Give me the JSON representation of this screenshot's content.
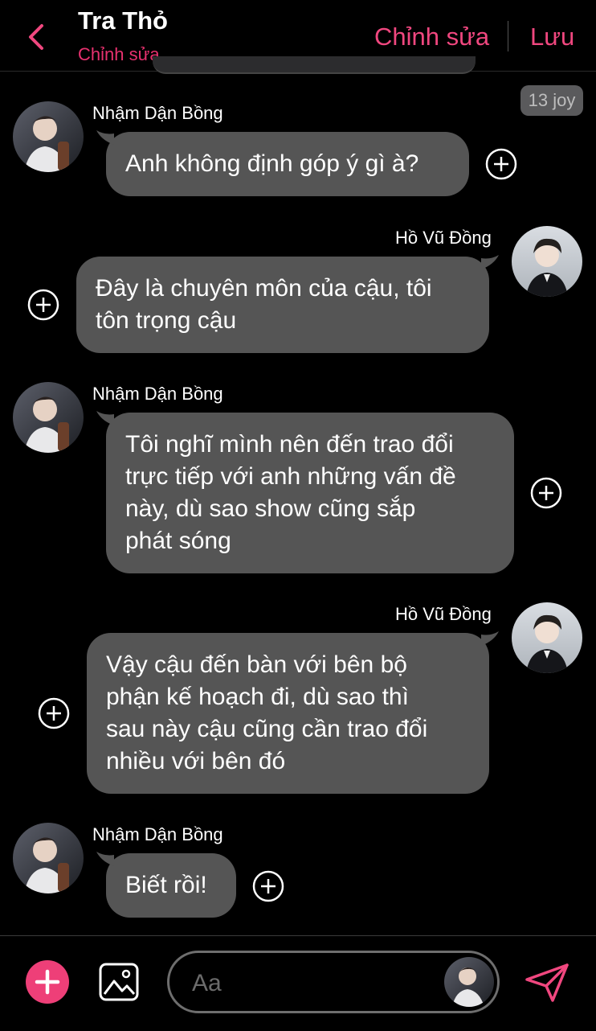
{
  "header": {
    "title": "Tra Thỏ",
    "subtitle": "Chỉnh sửa",
    "edit_label": "Chỉnh sửa",
    "save_label": "Lưu"
  },
  "time_badge": "13 joy",
  "messages": [
    {
      "sender": "Nhậm Dận Bồng",
      "side": "left",
      "lines": [
        "Anh không định góp ý gì à?"
      ]
    },
    {
      "sender": "Hồ Vũ Đồng",
      "side": "right",
      "lines": [
        "Đây là chuyên môn của cậu, tôi",
        "tôn trọng cậu"
      ]
    },
    {
      "sender": "Nhậm Dận Bồng",
      "side": "left",
      "lines": [
        "Tôi nghĩ mình nên đến trao đổi",
        "trực tiếp với anh những vấn đề",
        "này, dù sao show cũng sắp",
        "phát sóng"
      ]
    },
    {
      "sender": "Hồ Vũ Đồng",
      "side": "right",
      "lines": [
        "Vậy cậu đến bàn với bên bộ",
        "phận kế hoạch đi, dù sao thì",
        "sau này cậu cũng cần trao đổi",
        "nhiều với bên đó"
      ]
    },
    {
      "sender": "Nhậm Dận Bồng",
      "side": "left",
      "lines": [
        "Biết rồi!"
      ]
    }
  ],
  "composer": {
    "placeholder": "Aa"
  },
  "colors": {
    "accent": "#f0477f",
    "bubble": "#555555",
    "background": "#000000"
  },
  "icons": [
    "back-chevron-icon",
    "plus-circle-icon",
    "image-icon",
    "send-icon"
  ]
}
